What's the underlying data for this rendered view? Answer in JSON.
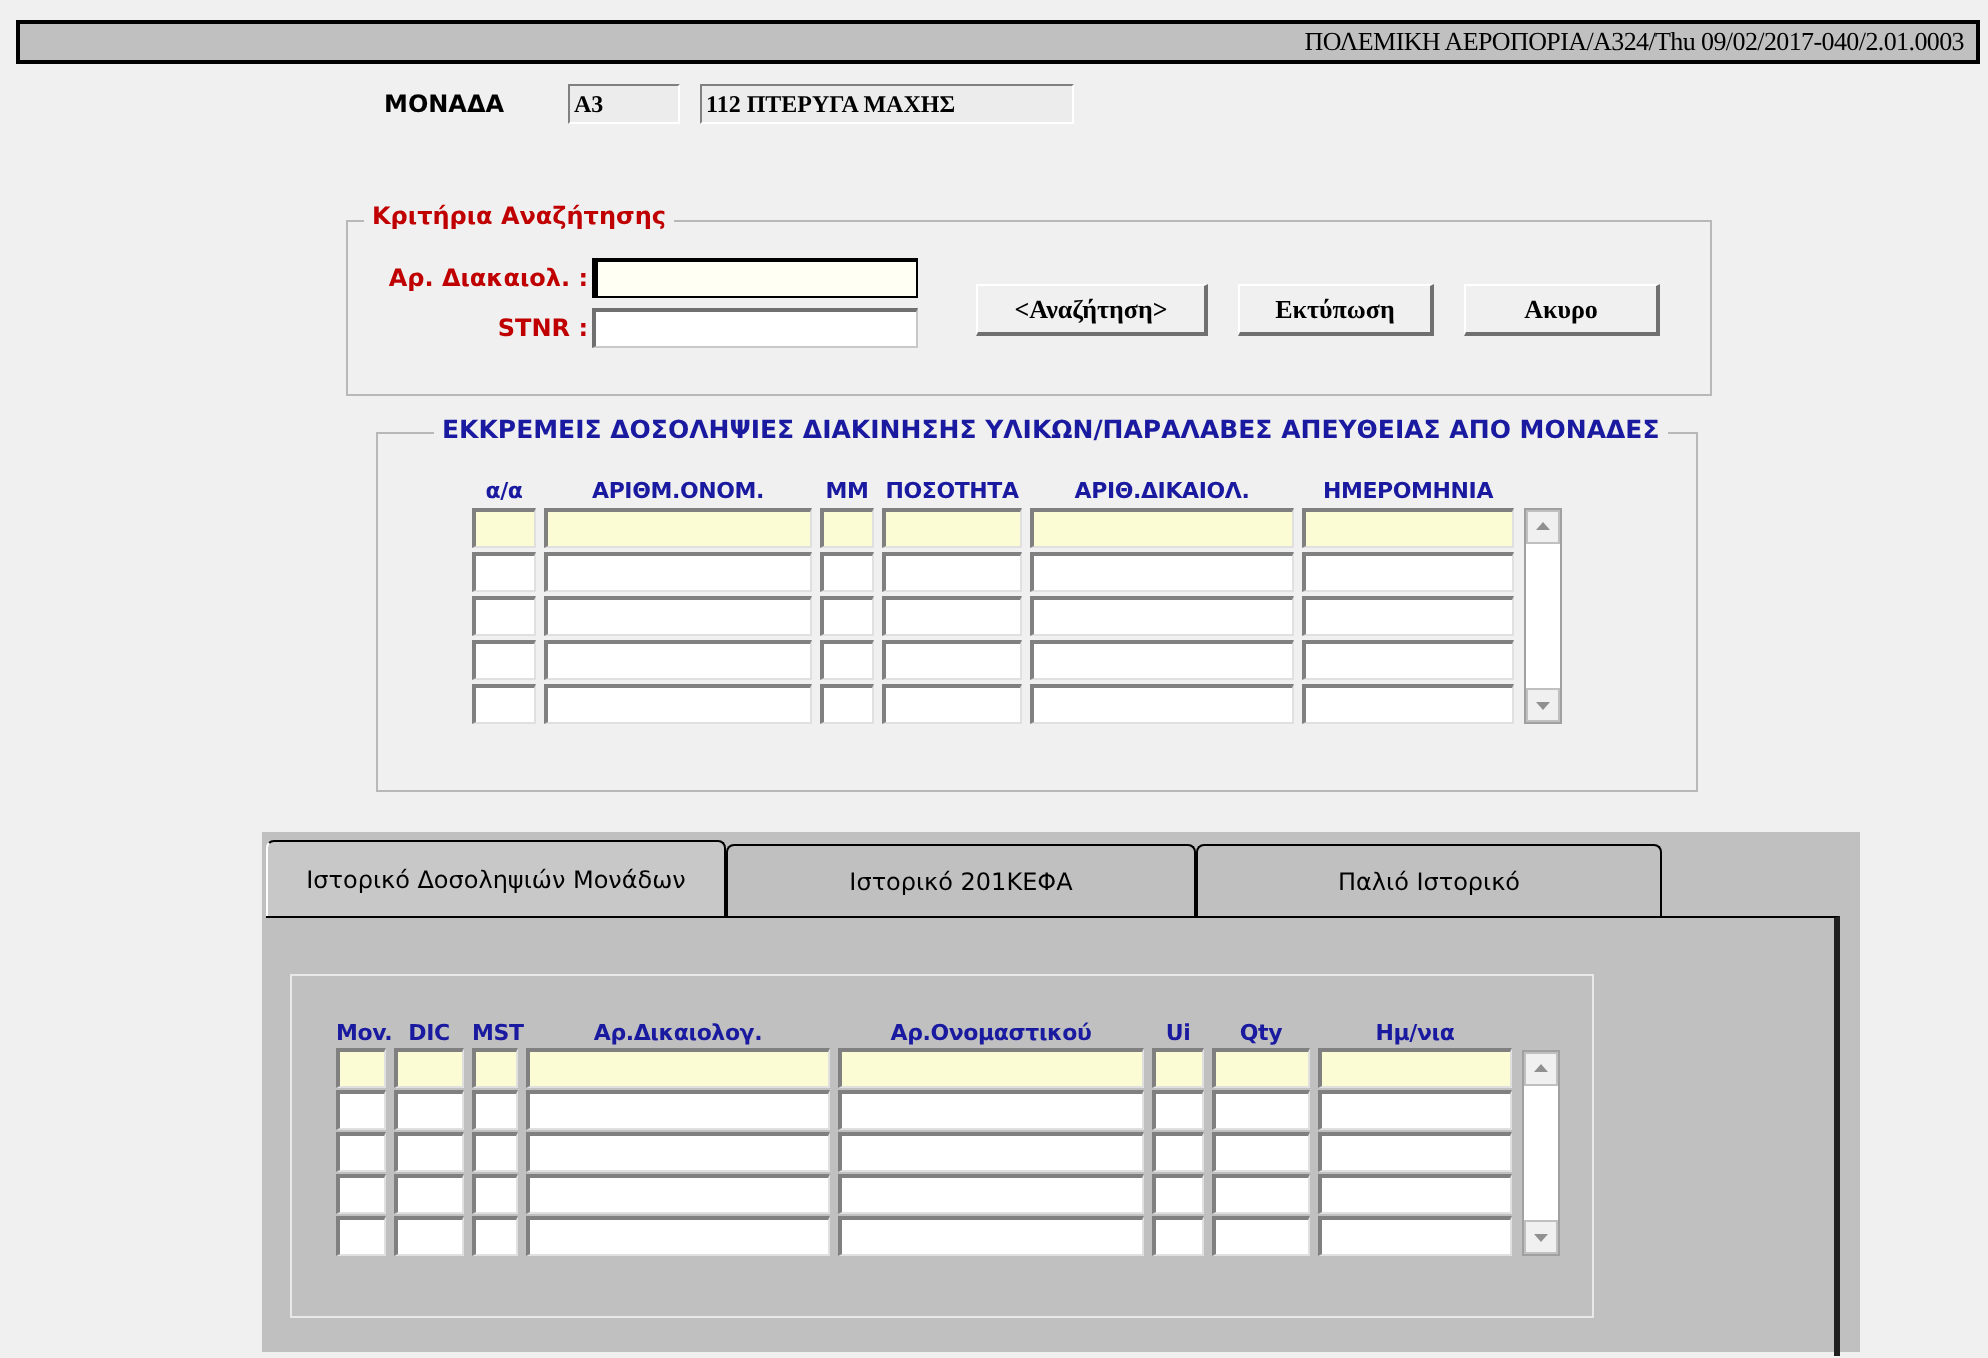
{
  "title_bar": {
    "text": "ΠΟΛΕΜΙΚΗ ΑΕΡΟΠΟΡΙΑ/A324/Thu 09/02/2017-040/2.01.0003"
  },
  "unit": {
    "label": "ΜΟΝΑΔΑ",
    "code": "A3",
    "name": "112 ΠΤΕΡΥΓΑ ΜΑΧΗΣ"
  },
  "search_criteria": {
    "title": "Κριτήρια Αναζήτησης",
    "fields": [
      {
        "label": "Αρ. Διακαιολ. :",
        "focused": true
      },
      {
        "label": "STNR :",
        "focused": false
      }
    ],
    "buttons": [
      "<Αναζήτηση>",
      "Εκτύπωση",
      "Ακυρο"
    ]
  },
  "pending_table": {
    "title": "ΕΚΚΡΕΜΕΙΣ ΔΟΣΟΛΗΨΙΕΣ ΔΙΑΚΙΝΗΣΗΣ ΥΛΙΚΩΝ/ΠΑΡΑΛΑΒΕΣ ΑΠΕΥΘΕΙΑΣ ΑΠΟ ΜΟΝΑΔΕΣ",
    "columns": [
      "α/α",
      "ΑΡΙΘΜ.ΟΝΟΜ.",
      "ΜΜ",
      "ΠΟΣΟΤΗΤΑ",
      "ΑΡΙΘ.ΔΙΚΑΙΟΛ.",
      "ΗΜΕΡΟΜΗΝΙΑ"
    ],
    "rows": [
      {
        "selected": true
      },
      {
        "selected": false
      },
      {
        "selected": false
      },
      {
        "selected": false
      },
      {
        "selected": false
      }
    ]
  },
  "tabs": [
    {
      "label": "Ιστορικό Δοσοληψιών Μονάδων",
      "selected": true
    },
    {
      "label": "Ιστορικό 201ΚΕΦΑ",
      "selected": false
    },
    {
      "label": "Παλιό Ιστορικό",
      "selected": false
    }
  ],
  "history_table": {
    "columns": [
      "Mov.",
      "DIC",
      "MST",
      "Αρ.Δικαιολογ.",
      "Αρ.Ονομαστικού",
      "Ui",
      "Qty",
      "Ημ/νια"
    ],
    "rows": [
      {
        "selected": true
      },
      {
        "selected": false
      },
      {
        "selected": false
      },
      {
        "selected": false
      },
      {
        "selected": false
      }
    ]
  }
}
